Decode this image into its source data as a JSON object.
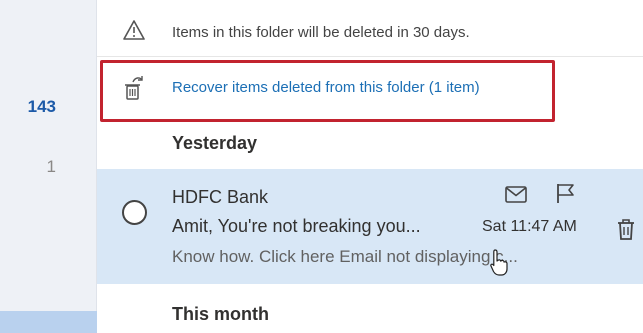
{
  "folder_counts": [
    "143",
    "1"
  ],
  "info": {
    "icon": "warning-icon",
    "text": "Items in this folder will be deleted in 30 days."
  },
  "recover": {
    "icon": "recycle-bin-icon",
    "link_text": "Recover items deleted from this folder (1 item)",
    "highlight_color": "#c2232f"
  },
  "groups": {
    "yesterday": "Yesterday",
    "this_month": "This month"
  },
  "message": {
    "sender": "HDFC Bank",
    "subject": "Amit, You're not breaking you...",
    "preview": "Know how. Click here Email not displaying c...",
    "time": "Sat 11:47 AM",
    "actions": [
      "envelope-icon",
      "flag-icon",
      "trash-icon"
    ]
  },
  "colors": {
    "accent": "#1c6fb5",
    "selected_row": "#d8e7f6"
  }
}
